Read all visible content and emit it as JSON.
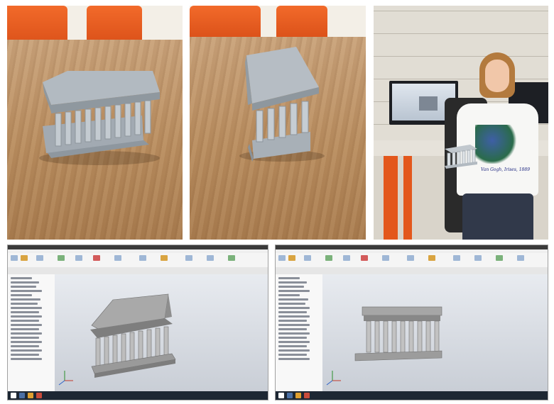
{
  "figure": {
    "panels": [
      {
        "id": "photo-front",
        "kind": "photo",
        "subject": "3d-printed-temple-model"
      },
      {
        "id": "photo-angled",
        "kind": "photo",
        "subject": "3d-printed-temple-model"
      },
      {
        "id": "photo-student",
        "kind": "photo",
        "subject": "student-holding-model"
      },
      {
        "id": "cad-isometric",
        "kind": "cad-screenshot",
        "view": "isometric"
      },
      {
        "id": "cad-front",
        "kind": "cad-screenshot",
        "view": "front"
      }
    ],
    "tshirt_caption": "Van Gogh, Irises, 1889",
    "colors": {
      "wood": "#b88c5e",
      "chair_orange": "#e85a20",
      "print_gray": "#9aa3ab",
      "cad_model_gray": "#8f8f8f",
      "viewport_bg": "#d3d7de",
      "taskbar": "#1d2733"
    }
  }
}
